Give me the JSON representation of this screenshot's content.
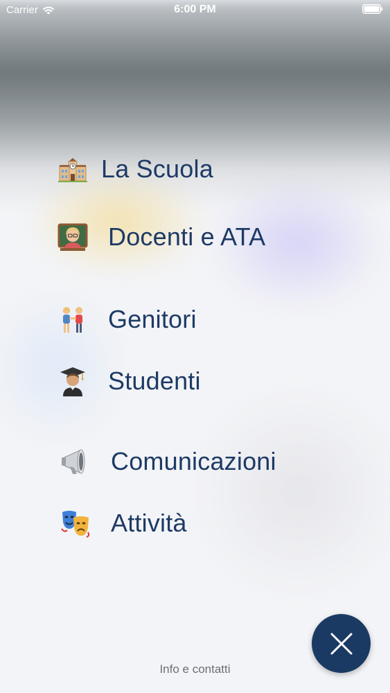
{
  "status_bar": {
    "carrier": "Carrier",
    "time": "6:00 PM"
  },
  "menu": {
    "items": [
      {
        "label": "La Scuola",
        "icon": "school-icon"
      },
      {
        "label": "Docenti e ATA",
        "icon": "teacher-icon"
      },
      {
        "label": "Genitori",
        "icon": "parents-icon"
      },
      {
        "label": "Studenti",
        "icon": "student-icon"
      },
      {
        "label": "Comunicazioni",
        "icon": "megaphone-icon"
      },
      {
        "label": "Attività",
        "icon": "theater-masks-icon"
      }
    ]
  },
  "footer": {
    "info_label": "Info e contatti"
  },
  "colors": {
    "accent": "#1b3a63",
    "label": "#1e3a66"
  }
}
